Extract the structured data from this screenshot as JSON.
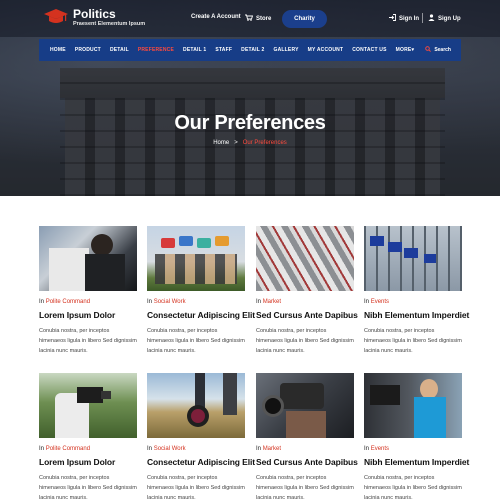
{
  "brand": {
    "title": "Politics",
    "subtitle": "Praesent Elementum Ipsum"
  },
  "topbar": {
    "create_account": "Create A Account",
    "store": "Store",
    "charity": "Charity",
    "sign_in": "Sign In",
    "sign_up": "Sign Up"
  },
  "nav": {
    "items": [
      "HOME",
      "PRODUCT",
      "DETAIL",
      "PREFERENCE",
      "DETAIL 1",
      "STAFF",
      "DETAIL 2",
      "GALLERY",
      "MY ACCOUNT",
      "CONTACT US",
      "MORE"
    ],
    "active_index": 3,
    "search": "Search"
  },
  "hero": {
    "title": "Our Preferences",
    "breadcrumb_home": "Home",
    "breadcrumb_sep": ">",
    "breadcrumb_current": "Our Preferences"
  },
  "cards": [
    {
      "in": "In",
      "category": "Polite Command",
      "title": "Lorem Ipsum Dolor",
      "body": "Conubia nostra, per inceptos himenaeos ligula in libero Sed dignissim lacinia nunc mauris."
    },
    {
      "in": "In",
      "category": "Social Work",
      "title": "Consectetur Adipiscing Elit",
      "body": "Conubia nostra, per inceptos himenaeos ligula in libero Sed dignissim lacinia nunc mauris."
    },
    {
      "in": "In",
      "category": "Market",
      "title": "Sed Cursus Ante Dapibus",
      "body": "Conubia nostra, per inceptos himenaeos ligula in libero Sed dignissim lacinia nunc mauris."
    },
    {
      "in": "In",
      "category": "Events",
      "title": "Nibh Elementum Imperdiet",
      "body": "Conubia nostra, per inceptos himenaeos ligula in libero Sed dignissim lacinia nunc mauris."
    },
    {
      "in": "In",
      "category": "Polite Command",
      "title": "Lorem Ipsum Dolor",
      "body": "Conubia nostra, per inceptos himenaeos ligula in libero Sed dignissim lacinia nunc mauris."
    },
    {
      "in": "In",
      "category": "Social Work",
      "title": "Consectetur Adipiscing Elit",
      "body": "Conubia nostra, per inceptos himenaeos ligula in libero Sed dignissim lacinia nunc mauris."
    },
    {
      "in": "In",
      "category": "Market",
      "title": "Sed Cursus Ante Dapibus",
      "body": "Conubia nostra, per inceptos himenaeos ligula in libero Sed dignissim lacinia nunc mauris."
    },
    {
      "in": "In",
      "category": "Events",
      "title": "Nibh Elementum Imperdiet",
      "body": "Conubia nostra, per inceptos himenaeos ligula in libero Sed dignissim lacinia nunc mauris."
    }
  ],
  "colors": {
    "nav_bg": "#173d87",
    "accent": "#d4321f",
    "charity_btn": "#1b3f8c",
    "active_nav": "#ff4a3d"
  }
}
